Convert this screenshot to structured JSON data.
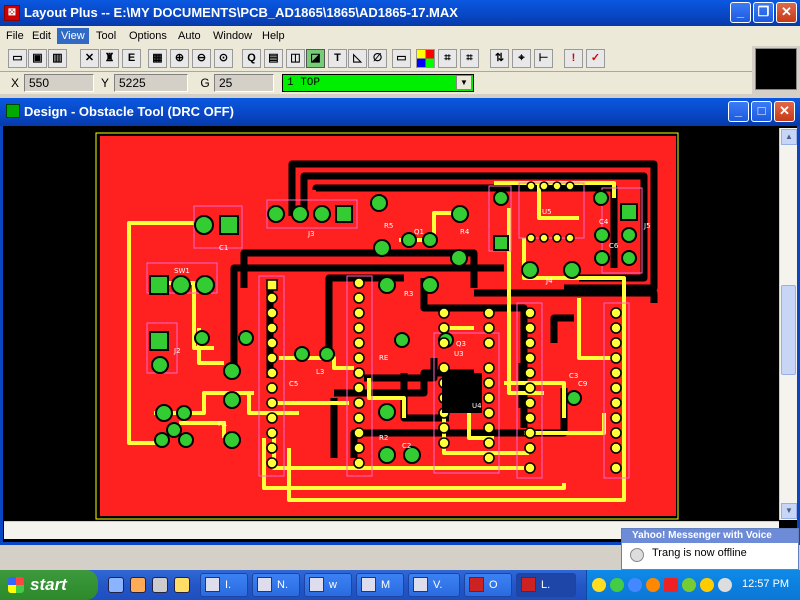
{
  "app": {
    "title": "Layout Plus -- E:\\MY DOCUMENTS\\PCB_AD1865\\1865\\AD1865-17.MAX"
  },
  "menu": {
    "items": [
      "File",
      "Edit",
      "View",
      "Tool",
      "Options",
      "Auto",
      "Window",
      "Help"
    ],
    "active": "View"
  },
  "toolbar": {
    "icons": [
      "open-icon",
      "save-icon",
      "print-icon",
      "stats-icon",
      "delete-icon",
      "find-icon",
      "edit-icon",
      "grid-icon",
      "zoom-in-icon",
      "zoom-out-icon",
      "zoom-all-icon",
      "query-icon",
      "component-icon",
      "pin-icon",
      "obstacle-icon",
      "text-icon",
      "connection-icon",
      "error-icon",
      "drc-icon",
      "color-icon",
      "reconnect-icon",
      "online-drc-icon",
      "shove-icon",
      "rotate-icon",
      "alert-icon",
      "drc-check-icon"
    ],
    "labels": {
      "query": "Q",
      "text": "T",
      "edit": "E"
    }
  },
  "coords": {
    "x_label": "X",
    "x_value": "550",
    "y_label": "Y",
    "y_value": "5225",
    "g_label": "G",
    "g_value": "25",
    "layer": "1 TOP"
  },
  "mdi": {
    "title": "Design - Obstacle Tool (DRC OFF)"
  },
  "board": {
    "ref_labels": [
      "J3",
      "R5",
      "Q1",
      "R4",
      "U5",
      "C6",
      "J5",
      "J4",
      "SW1",
      "C1",
      "R3",
      "J2",
      "C5",
      "U3",
      "U4",
      "C9",
      "R1",
      "R2",
      "C2",
      "C4",
      "C3",
      "L3",
      "Q3",
      "RE"
    ],
    "colors": {
      "background": "#000000",
      "board": "#ff2020",
      "trace_yellow": "#ffff3a",
      "trace_black": "#000000",
      "pad_green": "#33cc33"
    }
  },
  "yahoo": {
    "title": "Yahoo! Messenger with Voice",
    "message": "Trang is now offline"
  },
  "taskbar": {
    "start": "start",
    "tasks": [
      "I.",
      "N.",
      "w",
      "M",
      "V.",
      "O",
      "L."
    ],
    "active_task": 6,
    "clock": "12:57 PM"
  }
}
